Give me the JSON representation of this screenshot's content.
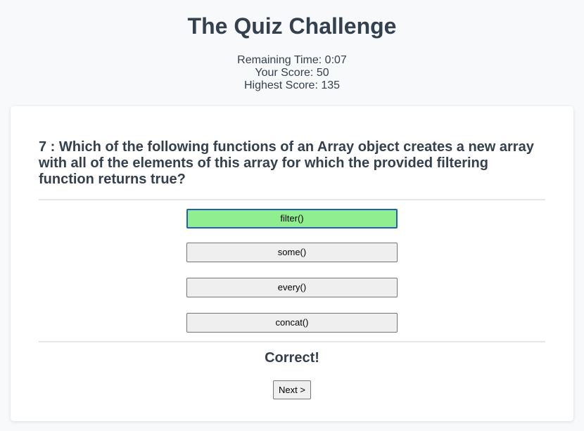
{
  "header": {
    "title": "The Quiz Challenge",
    "remaining_time": "Remaining Time: 0:07",
    "score": "Your Score: 50",
    "highest_score": "Highest Score: 135"
  },
  "quiz": {
    "question": "7 : Which of the following functions of an Array object creates a new array with all of the elements of this array for which the provided filtering function returns true?",
    "options": [
      {
        "label": "filter()",
        "selected": true
      },
      {
        "label": "some()",
        "selected": false
      },
      {
        "label": "every()",
        "selected": false
      },
      {
        "label": "concat()",
        "selected": false
      }
    ],
    "result": "Correct!",
    "next_label": "Next >"
  },
  "colors": {
    "selected_option": "#90ee90",
    "selected_border": "#1f5fb4",
    "text": "#34404d"
  }
}
